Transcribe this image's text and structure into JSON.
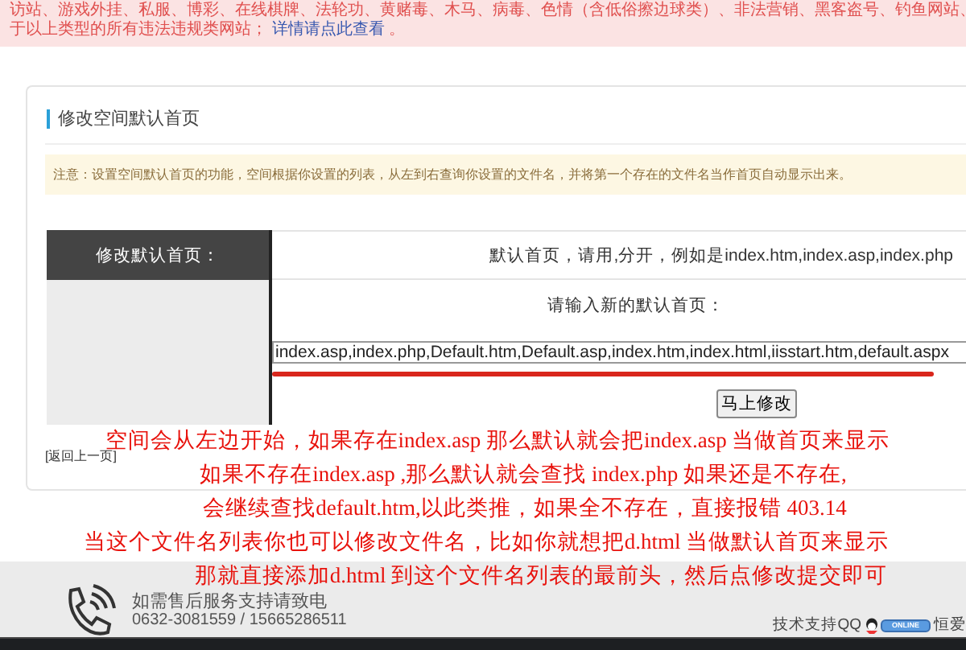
{
  "alert": {
    "lines": [
      "访站、游戏外挂、私服、博彩、在线棋牌、法轮功、黄赌毒、木马、病毒、色情（含低俗擦边球类）、非法营销、黑客盗号、钓鱼网站、",
      "于以上类型的所有违法违规类网站；"
    ],
    "link": "详情请点此查看",
    "tail": "。"
  },
  "panel": {
    "title": "修改空间默认首页",
    "notice": "注意：设置空间默认首页的功能，空间根据你设置的列表，从左到右查询你设置的文件名，并将第一个存在的文件名当作首页自动显示出来。",
    "form": {
      "label": "修改默认首页：",
      "hint": "默认首页，请用,分开，例如是index.htm,index.asp,index.php",
      "prompt": "请输入新的默认首页：",
      "value": "index.asp,index.php,Default.htm,Default.asp,index.htm,index.html,iisstart.htm,default.aspx",
      "submit": "马上修改"
    },
    "back_link": "[返回上一页]"
  },
  "annotations": [
    "空间会从左边开始，如果存在index.asp 那么默认就会把index.asp 当做首页来显示",
    "如果不存在index.asp ,那么默认就会查找 index.php 如果还是不存在,",
    "会继续查找default.htm,以此类推，如果全不存在，直接报错 403.14",
    "当这个文件名列表你也可以修改文件名，比如你就想把d.html 当做默认首页来显示",
    "那就直接添加d.html 到这个文件名列表的最前头，然后点修改提交即可"
  ],
  "footer": {
    "service_label": "如需售后服务支持请致电",
    "phone": "0632-3081559 / 15665286511",
    "support_label": "技术支持QQ",
    "qq_badge": "ONLINE",
    "site": "恒爱"
  }
}
